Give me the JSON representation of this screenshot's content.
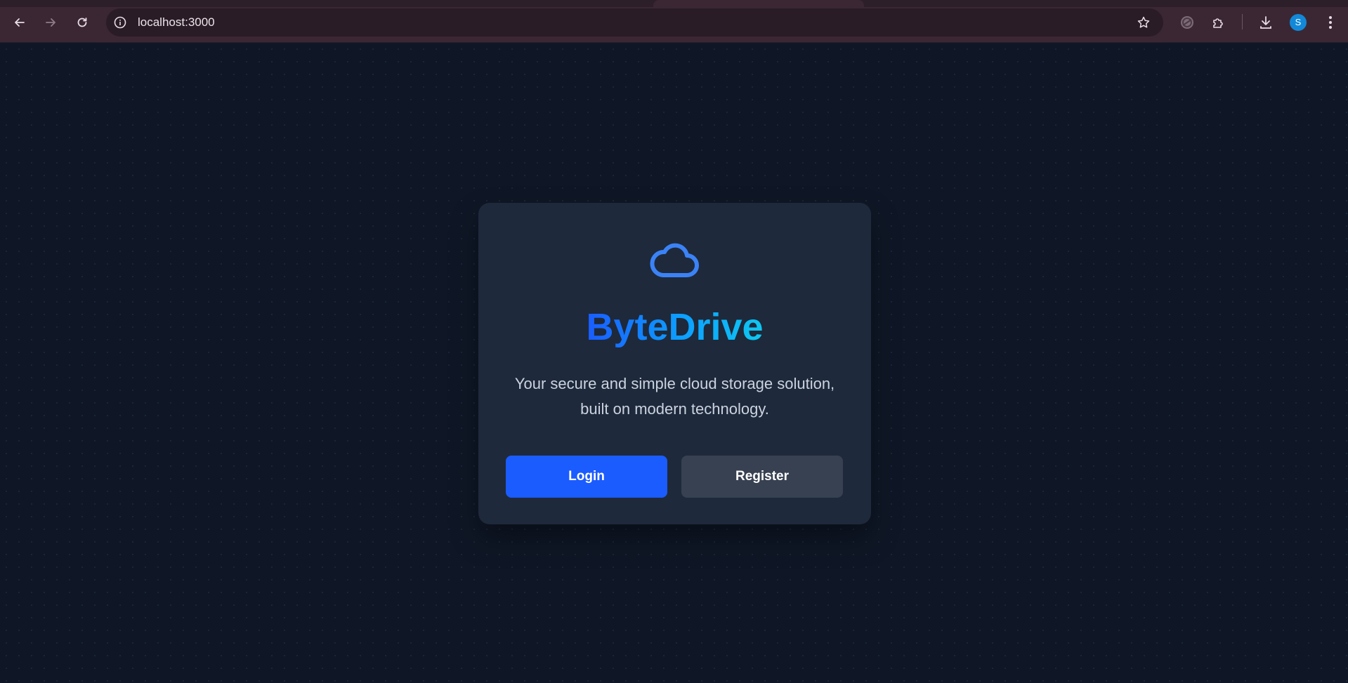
{
  "browser": {
    "url": "localhost:3000",
    "profile_initial": "S",
    "icons": [
      "back-arrow-icon",
      "forward-arrow-icon",
      "reload-icon",
      "info-icon",
      "star-icon",
      "extension-icon",
      "puzzle-icon",
      "download-icon",
      "kebab-menu-icon"
    ]
  },
  "app": {
    "logo_icon": "cloud-icon",
    "brand_name": "ByteDrive",
    "tagline": "Your secure and simple cloud storage solution, built on modern technology.",
    "login_label": "Login",
    "register_label": "Register"
  },
  "colors": {
    "background": "#0f1726",
    "card": "#1e293b",
    "primary": "#1b5cff",
    "secondary": "#374151",
    "brand_gradient_start": "#1a5cff",
    "brand_gradient_end": "#0ec7f0"
  }
}
